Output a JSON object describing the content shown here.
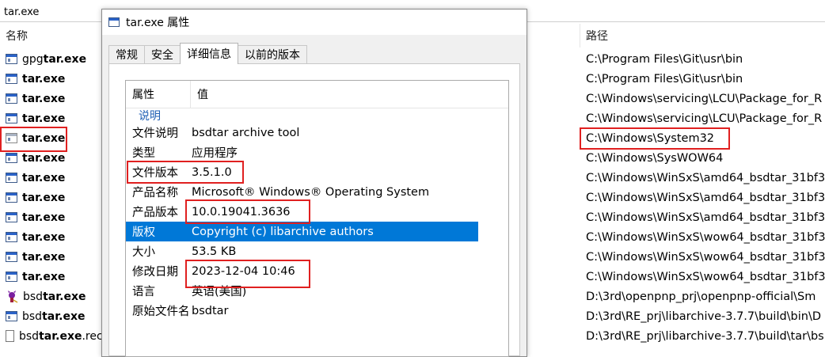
{
  "search": {
    "value": "tar.exe"
  },
  "columns": {
    "name": "名称",
    "path": "路径"
  },
  "files": [
    {
      "icon": "exe-icon",
      "pre": "gpg",
      "bold": "tar.exe",
      "post": ""
    },
    {
      "icon": "exe-icon",
      "pre": "",
      "bold": "tar.exe",
      "post": ""
    },
    {
      "icon": "exe-icon",
      "pre": "",
      "bold": "tar.exe",
      "post": ""
    },
    {
      "icon": "exe-icon",
      "pre": "",
      "bold": "tar.exe",
      "post": ""
    },
    {
      "icon": "exe-icon-grey",
      "pre": "",
      "bold": "tar.exe",
      "post": ""
    },
    {
      "icon": "exe-icon",
      "pre": "",
      "bold": "tar.exe",
      "post": ""
    },
    {
      "icon": "exe-icon",
      "pre": "",
      "bold": "tar.exe",
      "post": ""
    },
    {
      "icon": "exe-icon",
      "pre": "",
      "bold": "tar.exe",
      "post": ""
    },
    {
      "icon": "exe-icon",
      "pre": "",
      "bold": "tar.exe",
      "post": ""
    },
    {
      "icon": "exe-icon",
      "pre": "",
      "bold": "tar.exe",
      "post": ""
    },
    {
      "icon": "exe-icon",
      "pre": "",
      "bold": "tar.exe",
      "post": ""
    },
    {
      "icon": "exe-icon",
      "pre": "",
      "bold": "tar.exe",
      "post": ""
    },
    {
      "icon": "bsd-daemon-icon",
      "pre": "bsd",
      "bold": "tar.exe",
      "post": ""
    },
    {
      "icon": "exe-icon",
      "pre": "bsd",
      "bold": "tar.exe",
      "post": ""
    },
    {
      "icon": "document-icon",
      "pre": "bsd",
      "bold": "tar.exe",
      "post": ".rec"
    }
  ],
  "paths": [
    "C:\\Program Files\\Git\\usr\\bin",
    "C:\\Program Files\\Git\\usr\\bin",
    "C:\\Windows\\servicing\\LCU\\Package_for_R",
    "C:\\Windows\\servicing\\LCU\\Package_for_R",
    "C:\\Windows\\System32",
    "C:\\Windows\\SysWOW64",
    "C:\\Windows\\WinSxS\\amd64_bsdtar_31bf3",
    "C:\\Windows\\WinSxS\\amd64_bsdtar_31bf3",
    "C:\\Windows\\WinSxS\\amd64_bsdtar_31bf3",
    "C:\\Windows\\WinSxS\\wow64_bsdtar_31bf3",
    "C:\\Windows\\WinSxS\\wow64_bsdtar_31bf3",
    "C:\\Windows\\WinSxS\\wow64_bsdtar_31bf3",
    "D:\\3rd\\openpnp_prj\\openpnp-official\\Sm",
    "D:\\3rd\\RE_prj\\libarchive-3.7.7\\build\\bin\\D",
    "D:\\3rd\\RE_prj\\libarchive-3.7.7\\build\\tar\\bs"
  ],
  "dialog": {
    "title": "tar.exe 属性",
    "tabs": [
      "常规",
      "安全",
      "详细信息",
      "以前的版本"
    ],
    "active_tab": 2,
    "header": {
      "prop": "属性",
      "value": "值"
    },
    "group": "说明",
    "rows": [
      {
        "k": "文件说明",
        "v": "bsdtar archive tool"
      },
      {
        "k": "类型",
        "v": "应用程序"
      },
      {
        "k": "文件版本",
        "v": "3.5.1.0"
      },
      {
        "k": "产品名称",
        "v": "Microsoft® Windows® Operating System"
      },
      {
        "k": "产品版本",
        "v": "10.0.19041.3636"
      },
      {
        "k": "版权",
        "v": "Copyright (c) libarchive authors"
      },
      {
        "k": "大小",
        "v": "53.5 KB"
      },
      {
        "k": "修改日期",
        "v": "2023-12-04 10:46"
      },
      {
        "k": "语言",
        "v": "英语(美国)"
      },
      {
        "k": "原始文件名",
        "v": "bsdtar"
      }
    ],
    "selected_row": 5
  },
  "colors": {
    "selection": "#0078d7",
    "highlight_box": "#e02020",
    "group_text": "#1e5fb4"
  }
}
